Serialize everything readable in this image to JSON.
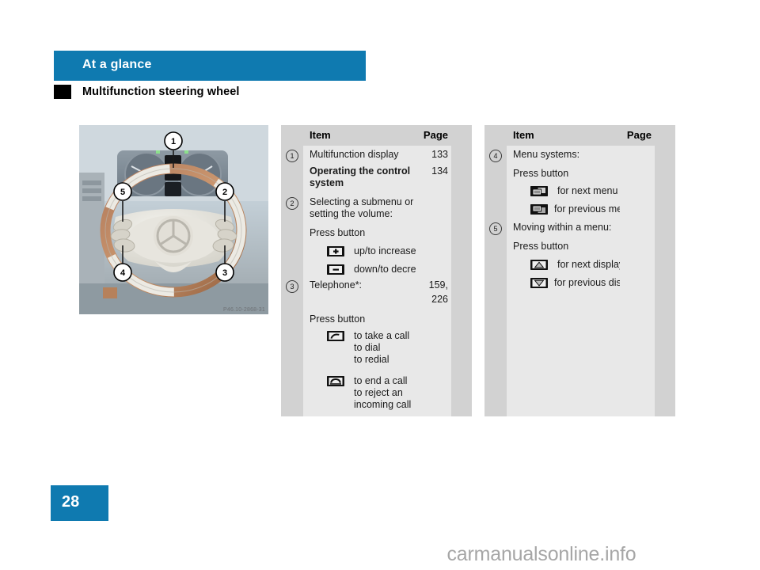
{
  "header": {
    "section_label": "At a glance",
    "topic_title": "Multifunction steering wheel",
    "accent_color": "#0f7ab0",
    "square_color": "#000000"
  },
  "figure": {
    "name": "multifunction-steering-wheel-photo",
    "caption_code": "P46.10-2868-31",
    "callouts": [
      "1",
      "2",
      "3",
      "4",
      "5"
    ]
  },
  "tables": [
    {
      "id": "table-left",
      "headers": {
        "item": "Item",
        "page": "Page"
      },
      "rows": [
        {
          "callout": "1",
          "text": "Multifunction display",
          "page": "133",
          "bold": false
        },
        {
          "callout": "",
          "text": "Operating the control",
          "page": "134",
          "bold": true
        },
        {
          "callout": "",
          "text": "system",
          "page": "",
          "bold": true
        },
        {
          "callout": "2",
          "text": "Selecting a submenu or",
          "page": "",
          "bold": false
        },
        {
          "callout": "",
          "text": "setting the volume:",
          "page": "",
          "bold": false
        },
        {
          "callout": "",
          "text": "Press button",
          "page": "",
          "bold": false
        },
        {
          "callout": "",
          "icon": "plus-button-icon",
          "text": "up/to increase",
          "page": "",
          "bold": false
        },
        {
          "callout": "",
          "icon": "minus-button-icon",
          "text": "down/to decrease",
          "page": "",
          "bold": false
        },
        {
          "callout": "3",
          "text": "Telephone*:",
          "page": "159,",
          "bold": false
        },
        {
          "callout": "",
          "text": "",
          "page": "226",
          "bold": false
        },
        {
          "callout": "",
          "text": "Press button",
          "page": "",
          "bold": false
        },
        {
          "callout": "",
          "icon": "phone-receiver-off-hook-icon",
          "text": "to take a call",
          "page": "",
          "bold": false
        },
        {
          "callout": "",
          "text": "to dial",
          "page": "",
          "bold": false
        },
        {
          "callout": "",
          "text": "to redial",
          "page": "",
          "bold": false
        },
        {
          "callout": "",
          "icon": "phone-receiver-on-hook-icon",
          "text": "to end a call",
          "page": "",
          "bold": false
        },
        {
          "callout": "",
          "text": "to reject an",
          "page": "",
          "bold": false
        },
        {
          "callout": "",
          "text": "incoming call",
          "page": "",
          "bold": false
        }
      ]
    },
    {
      "id": "table-right",
      "headers": {
        "item": "Item",
        "page": "Page"
      },
      "rows": [
        {
          "callout": "4",
          "text": "Menu systems:",
          "page": "",
          "bold": false
        },
        {
          "callout": "",
          "text": "Press button",
          "page": "",
          "bold": false
        },
        {
          "callout": "",
          "icon": "next-menu-icon",
          "text": "for next menu",
          "page": "",
          "bold": false
        },
        {
          "callout": "",
          "icon": "previous-menu-icon",
          "text": "for previous menu",
          "page": "",
          "bold": false
        },
        {
          "callout": "5",
          "text": "Moving within a menu:",
          "page": "",
          "bold": false
        },
        {
          "callout": "",
          "text": "Press button",
          "page": "",
          "bold": false
        },
        {
          "callout": "",
          "icon": "up-arrow-button-icon",
          "text": "for next display",
          "page": "",
          "bold": false
        },
        {
          "callout": "",
          "icon": "down-arrow-button-icon",
          "text": "for previous display",
          "page": "",
          "bold": false
        }
      ]
    }
  ],
  "footer": {
    "page_number": "28",
    "watermark": "carmanualsonline.info"
  }
}
